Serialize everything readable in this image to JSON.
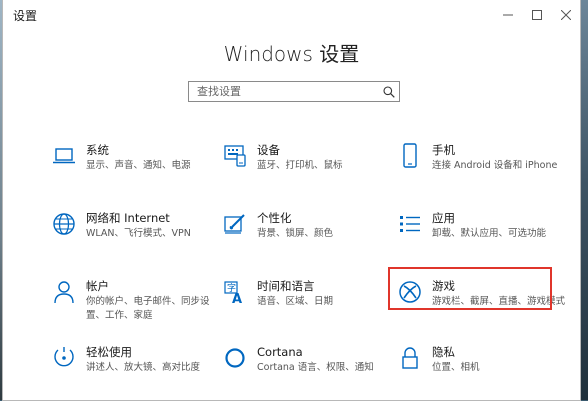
{
  "window": {
    "title": "设置",
    "controls": [
      "minimize",
      "maximize",
      "close"
    ]
  },
  "main": {
    "heading": "Windows 设置",
    "search_placeholder": "查找设置"
  },
  "tiles": [
    {
      "name": "系统",
      "desc1": "显示、声音、通知、电源",
      "desc2": "",
      "icon": "laptop-icon"
    },
    {
      "name": "设备",
      "desc1": "蓝牙、打印机、鼠标",
      "desc2": "",
      "icon": "keyboard-device-icon"
    },
    {
      "name": "手机",
      "desc1": "连接 Android 设备和 iPhone",
      "desc2": "",
      "icon": "phone-icon"
    },
    {
      "name": "网络和 Internet",
      "desc1": "WLAN、飞行模式、VPN",
      "desc2": "",
      "icon": "globe-icon"
    },
    {
      "name": "个性化",
      "desc1": "背景、锁屏、颜色",
      "desc2": "",
      "icon": "paint-brush-icon"
    },
    {
      "name": "应用",
      "desc1": "卸载、默认应用、可选功能",
      "desc2": "",
      "icon": "apps-list-icon"
    },
    {
      "name": "帐户",
      "desc1": "你的帐户、电子邮件、同步设",
      "desc2": "置、工作、家庭",
      "icon": "person-icon"
    },
    {
      "name": "时间和语言",
      "desc1": "语音、区域、日期",
      "desc2": "",
      "icon": "time-language-icon"
    },
    {
      "name": "游戏",
      "desc1": "游戏栏、截屏、直播、游戏模式",
      "desc2": "",
      "icon": "xbox-icon"
    },
    {
      "name": "轻松使用",
      "desc1": "讲述人、放大镜、高对比度",
      "desc2": "",
      "icon": "ease-of-access-icon"
    },
    {
      "name": "Cortana",
      "desc1": "Cortana 语言、权限、通知",
      "desc2": "",
      "icon": "cortana-icon"
    },
    {
      "name": "隐私",
      "desc1": "位置、相机",
      "desc2": "",
      "icon": "lock-icon"
    }
  ],
  "colors": {
    "accent": "#0067c0",
    "highlight": "#e0352b"
  }
}
